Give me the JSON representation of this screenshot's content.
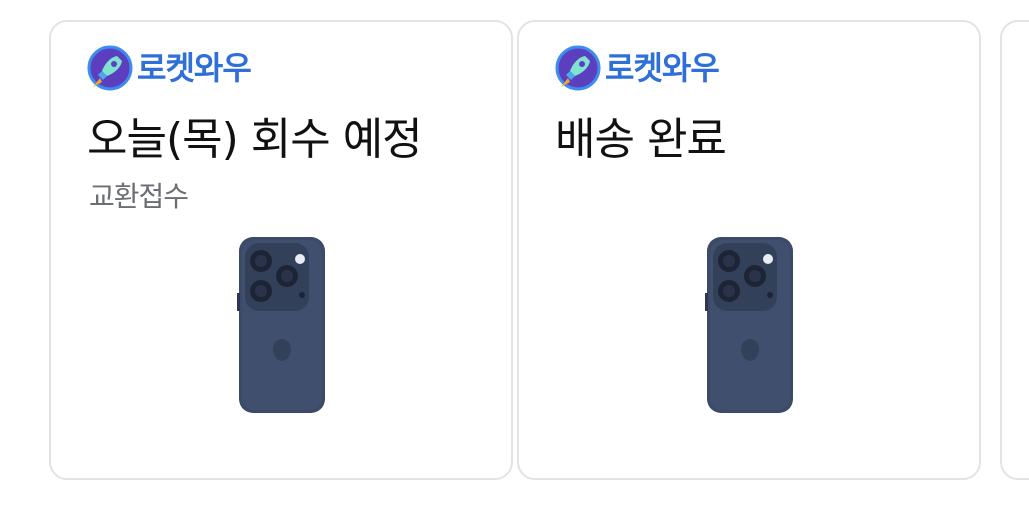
{
  "cards": [
    {
      "brand_label": "로켓와우",
      "status": "오늘(목) 회수 예정",
      "sub_status": "교환접수",
      "product_icon": "phone-product-image"
    },
    {
      "brand_label": "로켓와우",
      "status": "배송 완료",
      "sub_status": "",
      "product_icon": "phone-product-image"
    }
  ],
  "colors": {
    "brand_blue": "#2f6fd8",
    "rocket_purple": "#5b3fbf",
    "card_border": "#e2e3e6",
    "phone_body": "#3b4a66"
  }
}
